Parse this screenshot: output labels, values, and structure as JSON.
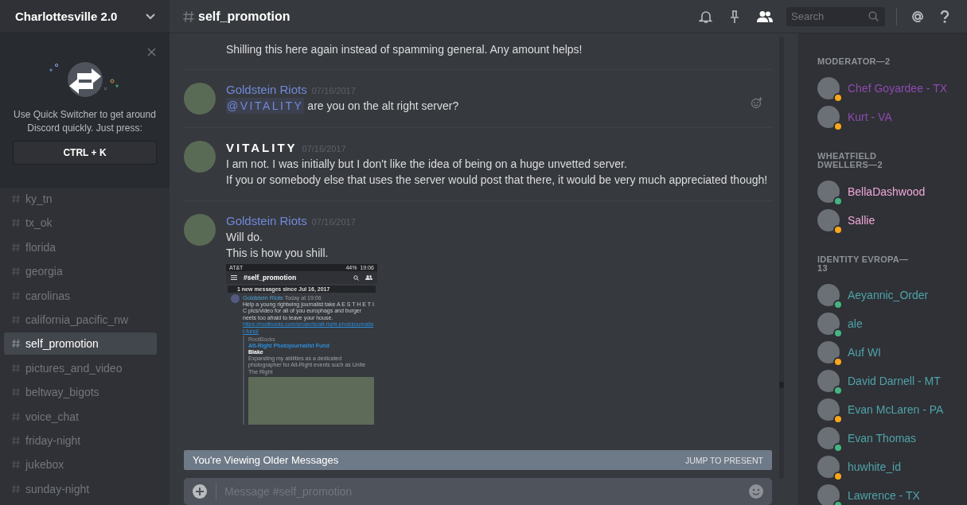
{
  "server": {
    "name": "Charlottesville 2.0"
  },
  "quick_switcher": {
    "text": "Use Quick Switcher to get around Discord quickly. Just press:",
    "shortcut": "CTRL + K"
  },
  "channels": [
    {
      "name": "ky_tn",
      "selected": false
    },
    {
      "name": "tx_ok",
      "selected": false
    },
    {
      "name": "florida",
      "selected": false
    },
    {
      "name": "georgia",
      "selected": false
    },
    {
      "name": "carolinas",
      "selected": false
    },
    {
      "name": "california_pacific_nw",
      "selected": false
    },
    {
      "name": "self_promotion",
      "selected": true
    },
    {
      "name": "pictures_and_video",
      "selected": false
    },
    {
      "name": "beltway_bigots",
      "selected": false
    },
    {
      "name": "voice_chat",
      "selected": false
    },
    {
      "name": "friday-night",
      "selected": false
    },
    {
      "name": "jukebox",
      "selected": false
    },
    {
      "name": "sunday-night",
      "selected": false
    }
  ],
  "header": {
    "channel": "self_promotion",
    "search": {
      "placeholder": "Search"
    }
  },
  "messages": [
    {
      "kind": "continuation",
      "lines": [
        "Shilling this here again instead of spamming general. Any amount helps!"
      ]
    },
    {
      "kind": "full",
      "author": "Goldstein Riots",
      "color": "#7289da",
      "timestamp": "07/16/2017",
      "mention": "@VITALITY",
      "lines": [
        "are you on the alt right server?"
      ]
    },
    {
      "kind": "full",
      "author": "VITALITY",
      "color": "#ffffff",
      "timestamp": "07/16/2017",
      "lines": [
        "I am not. I was initially but I don't like the idea of being on a huge unvetted server.",
        "If you or somebody else that uses the server would post that there, it would be very much appreciated though!"
      ]
    },
    {
      "kind": "full",
      "author": "Goldstein Riots",
      "color": "#7289da",
      "timestamp": "07/16/2017",
      "lines": [
        "Will do.",
        "This is how you shill."
      ],
      "attachment": {
        "carrier": "AT&T",
        "battery": "44%",
        "clock": "19:06",
        "channel": "#self_promotion",
        "new_messages": "1 new messages since Jul 16, 2017",
        "author": "Goldstein Riots",
        "timestamp": "Today at 19:06",
        "text": "Help a young rightwing journalist take A E S T H E T I C pics/video for all of you europhags and burger neets too afraid to leave your house.",
        "link": "https://rootbocks.com/projects/alt-right-photojournalist-fund/",
        "embed": {
          "provider": "RootBocks",
          "title": "Alt-Right Photojournalist Fund",
          "author": "Blake",
          "description": "Expanding my abilities as a dedicated photographer for Alt-Right events such as Unite The Right"
        }
      }
    }
  ],
  "older_bar": {
    "text": "You're Viewing Older Messages",
    "action": "JUMP TO PRESENT"
  },
  "composer": {
    "placeholder": "Message #self_promotion"
  },
  "member_groups": [
    {
      "title": "MODERATOR—2",
      "color": "#8e4ab0",
      "members": [
        {
          "name": "Chef Goyardee - TX",
          "color": "#faa61a"
        },
        {
          "name": "Kurt - VA",
          "color": "#faa61a"
        }
      ]
    },
    {
      "title": "WHEATFIELD DWELLERS—2",
      "color": "#f1a7da",
      "members": [
        {
          "name": "BellaDashwood",
          "color": "#43b581"
        },
        {
          "name": "Sallie",
          "color": "#faa61a"
        }
      ]
    },
    {
      "title": "IDENTITY EVROPA—13",
      "color": "#4fa3a8",
      "members": [
        {
          "name": "Aeyannic_Order",
          "color": "#43b581"
        },
        {
          "name": "ale",
          "color": "#43b581"
        },
        {
          "name": "Auf WI",
          "color": "#faa61a"
        },
        {
          "name": "David Darnell - MT",
          "color": "#43b581"
        },
        {
          "name": "Evan McLaren - PA",
          "color": "#faa61a"
        },
        {
          "name": "Evan Thomas",
          "color": "#43b581"
        },
        {
          "name": "huwhite_id",
          "color": "#faa61a"
        },
        {
          "name": "Lawrence - TX",
          "color": "#43b581"
        }
      ]
    }
  ]
}
